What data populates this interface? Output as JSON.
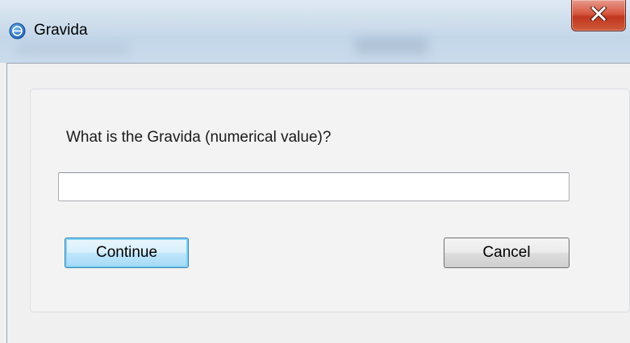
{
  "window": {
    "title": "Gravida",
    "icon": "app-globe-icon",
    "close_icon": "close-x-icon"
  },
  "dialog": {
    "question": "What is the Gravida (numerical value)?",
    "input_value": "",
    "continue_label": "Continue",
    "cancel_label": "Cancel"
  },
  "colors": {
    "close_button": "#c8452c",
    "default_button_border": "#3c7fb1"
  }
}
